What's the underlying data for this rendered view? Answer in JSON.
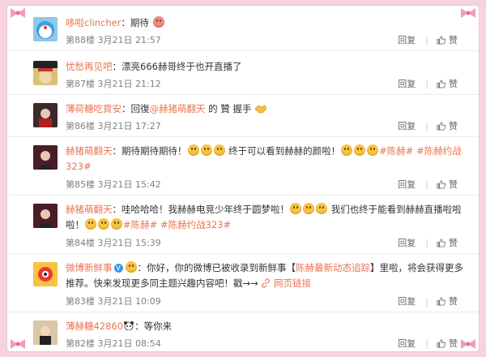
{
  "comments": [
    {
      "user": "哆啦clincher",
      "sep": "：",
      "text": "期待",
      "floor": "第88楼",
      "time": "3月21日 21:57",
      "reply_label": "回复",
      "like_label": "赞",
      "avatar_color": "#8fc8e8"
    },
    {
      "user": "忧愁再见吧",
      "sep": "：",
      "text": "漂亮666赫哥终于也开直播了",
      "floor": "第87楼",
      "time": "3月21日 21:12",
      "reply_label": "回复",
      "like_label": "赞",
      "avatar_color": "#d8c27a"
    },
    {
      "user": "薄荷糖吃貨安",
      "sep": "：",
      "text_a": "回復",
      "mention": "@赫猪萌翻天",
      "text_b": " 的 贊 握手",
      "floor": "第86楼",
      "time": "3月21日 17:27",
      "reply_label": "回复",
      "like_label": "赞",
      "avatar_color": "#6b3a3a"
    },
    {
      "user": "赫猪萌翻天",
      "sep": "：",
      "line1_a": "期待期待期待！",
      "line1_b": "终于可以看到赫赫的颜啦！",
      "tag1": "#陈赫#",
      "tag2": "#陈赫约战",
      "line2_tag": "323#",
      "floor": "第85楼",
      "time": "3月21日 15:42",
      "reply_label": "回复",
      "like_label": "赞",
      "avatar_color": "#5a2430"
    },
    {
      "user": "赫猪萌翻天",
      "sep": "：",
      "line1_a": "哇哈哈哈！我赫赫电竞少年终于圆梦啦！",
      "line1_b": "我们也终于能看到赫赫直播啦啦",
      "line2_a": "啦！",
      "tag1": "#陈赫#",
      "tag2": "#陈赫约战323#",
      "floor": "第84楼",
      "time": "3月21日 15:39",
      "reply_label": "回复",
      "like_label": "赞",
      "avatar_color": "#5a2430"
    },
    {
      "user": "微博新鲜事",
      "sep": "：",
      "line1_a": "你好，你的微博已被收录到新鲜事【",
      "line1_link": "陈赫最新动态追踪",
      "line1_b": "】里啦，将会获得更多",
      "line2_a": "推荐。快来发现更多同主题兴趣内容吧！戳→→ ",
      "line2_link": "网页链接",
      "floor": "第83楼",
      "time": "3月21日 10:09",
      "reply_label": "回复",
      "like_label": "赞",
      "avatar_color": "#f2b632"
    },
    {
      "user": "薄赫糖42860",
      "sep": "：",
      "text": "等你来",
      "floor": "第82楼",
      "time": "3月21日 08:54",
      "reply_label": "回复",
      "like_label": "赞",
      "avatar_color": "#c8b090"
    }
  ]
}
